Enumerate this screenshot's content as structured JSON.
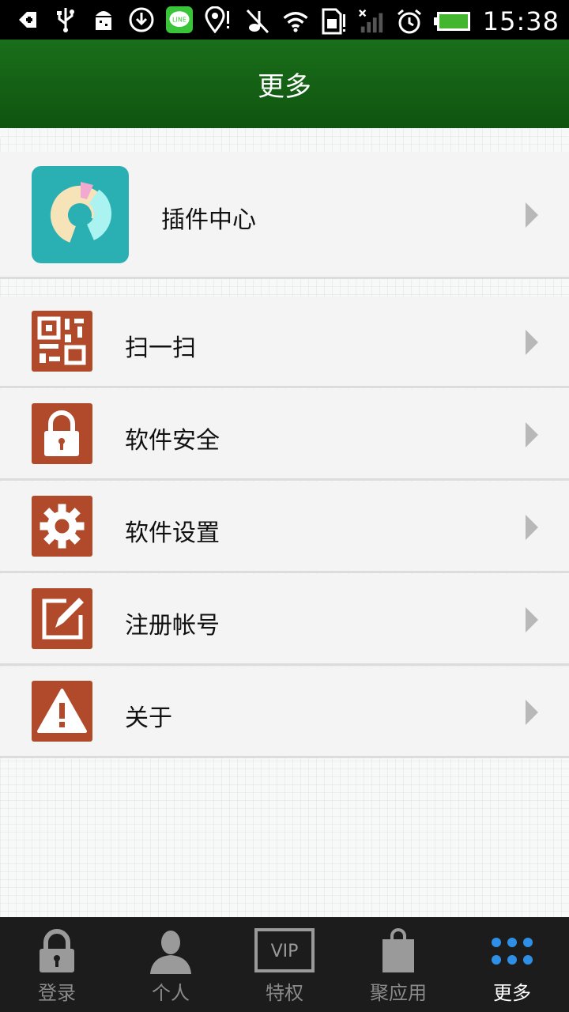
{
  "status_bar": {
    "time": "15:38",
    "icons_left": [
      "back-icon",
      "usb-icon",
      "android-debug-icon",
      "download-icon",
      "line-app-icon",
      "location-icon"
    ],
    "icons_right": [
      "mute-icon",
      "wifi-icon",
      "sim-icon",
      "signal-icon",
      "alarm-icon",
      "battery-icon"
    ],
    "line_label": "LINE"
  },
  "header": {
    "title": "更多"
  },
  "menu": {
    "plugin": {
      "label": "插件中心",
      "icon": "plugin-center-icon"
    },
    "items": [
      {
        "label": "扫一扫",
        "icon": "qr-code-icon"
      },
      {
        "label": "软件安全",
        "icon": "lock-icon"
      },
      {
        "label": "软件设置",
        "icon": "gear-icon"
      },
      {
        "label": "注册帐号",
        "icon": "edit-icon"
      },
      {
        "label": "关于",
        "icon": "warning-icon"
      }
    ]
  },
  "tabs": [
    {
      "label": "登录",
      "icon": "lock-icon"
    },
    {
      "label": "个人",
      "icon": "person-icon"
    },
    {
      "label": "特权",
      "icon": "vip-icon",
      "badge_text": "VIP"
    },
    {
      "label": "聚应用",
      "icon": "shopping-bag-icon"
    },
    {
      "label": "更多",
      "icon": "more-dots-icon",
      "active": true
    }
  ],
  "colors": {
    "header_green": "#145f14",
    "icon_brown": "#b04a2a",
    "plugin_teal": "#2ab0b3",
    "tab_active_dots": "#2f8fe6"
  }
}
